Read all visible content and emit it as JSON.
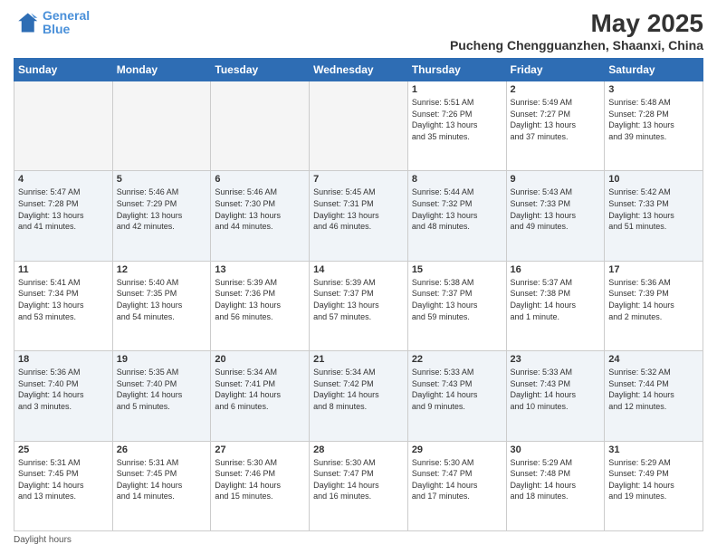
{
  "header": {
    "logo_line1": "General",
    "logo_line2": "Blue",
    "month": "May 2025",
    "location": "Pucheng Chengguanzhen, Shaanxi, China"
  },
  "days_of_week": [
    "Sunday",
    "Monday",
    "Tuesday",
    "Wednesday",
    "Thursday",
    "Friday",
    "Saturday"
  ],
  "footer": {
    "daylight_label": "Daylight hours"
  },
  "weeks": [
    {
      "days": [
        {
          "num": "",
          "info": ""
        },
        {
          "num": "",
          "info": ""
        },
        {
          "num": "",
          "info": ""
        },
        {
          "num": "",
          "info": ""
        },
        {
          "num": "1",
          "info": "Sunrise: 5:51 AM\nSunset: 7:26 PM\nDaylight: 13 hours\nand 35 minutes."
        },
        {
          "num": "2",
          "info": "Sunrise: 5:49 AM\nSunset: 7:27 PM\nDaylight: 13 hours\nand 37 minutes."
        },
        {
          "num": "3",
          "info": "Sunrise: 5:48 AM\nSunset: 7:28 PM\nDaylight: 13 hours\nand 39 minutes."
        }
      ]
    },
    {
      "days": [
        {
          "num": "4",
          "info": "Sunrise: 5:47 AM\nSunset: 7:28 PM\nDaylight: 13 hours\nand 41 minutes."
        },
        {
          "num": "5",
          "info": "Sunrise: 5:46 AM\nSunset: 7:29 PM\nDaylight: 13 hours\nand 42 minutes."
        },
        {
          "num": "6",
          "info": "Sunrise: 5:46 AM\nSunset: 7:30 PM\nDaylight: 13 hours\nand 44 minutes."
        },
        {
          "num": "7",
          "info": "Sunrise: 5:45 AM\nSunset: 7:31 PM\nDaylight: 13 hours\nand 46 minutes."
        },
        {
          "num": "8",
          "info": "Sunrise: 5:44 AM\nSunset: 7:32 PM\nDaylight: 13 hours\nand 48 minutes."
        },
        {
          "num": "9",
          "info": "Sunrise: 5:43 AM\nSunset: 7:33 PM\nDaylight: 13 hours\nand 49 minutes."
        },
        {
          "num": "10",
          "info": "Sunrise: 5:42 AM\nSunset: 7:33 PM\nDaylight: 13 hours\nand 51 minutes."
        }
      ]
    },
    {
      "days": [
        {
          "num": "11",
          "info": "Sunrise: 5:41 AM\nSunset: 7:34 PM\nDaylight: 13 hours\nand 53 minutes."
        },
        {
          "num": "12",
          "info": "Sunrise: 5:40 AM\nSunset: 7:35 PM\nDaylight: 13 hours\nand 54 minutes."
        },
        {
          "num": "13",
          "info": "Sunrise: 5:39 AM\nSunset: 7:36 PM\nDaylight: 13 hours\nand 56 minutes."
        },
        {
          "num": "14",
          "info": "Sunrise: 5:39 AM\nSunset: 7:37 PM\nDaylight: 13 hours\nand 57 minutes."
        },
        {
          "num": "15",
          "info": "Sunrise: 5:38 AM\nSunset: 7:37 PM\nDaylight: 13 hours\nand 59 minutes."
        },
        {
          "num": "16",
          "info": "Sunrise: 5:37 AM\nSunset: 7:38 PM\nDaylight: 14 hours\nand 1 minute."
        },
        {
          "num": "17",
          "info": "Sunrise: 5:36 AM\nSunset: 7:39 PM\nDaylight: 14 hours\nand 2 minutes."
        }
      ]
    },
    {
      "days": [
        {
          "num": "18",
          "info": "Sunrise: 5:36 AM\nSunset: 7:40 PM\nDaylight: 14 hours\nand 3 minutes."
        },
        {
          "num": "19",
          "info": "Sunrise: 5:35 AM\nSunset: 7:40 PM\nDaylight: 14 hours\nand 5 minutes."
        },
        {
          "num": "20",
          "info": "Sunrise: 5:34 AM\nSunset: 7:41 PM\nDaylight: 14 hours\nand 6 minutes."
        },
        {
          "num": "21",
          "info": "Sunrise: 5:34 AM\nSunset: 7:42 PM\nDaylight: 14 hours\nand 8 minutes."
        },
        {
          "num": "22",
          "info": "Sunrise: 5:33 AM\nSunset: 7:43 PM\nDaylight: 14 hours\nand 9 minutes."
        },
        {
          "num": "23",
          "info": "Sunrise: 5:33 AM\nSunset: 7:43 PM\nDaylight: 14 hours\nand 10 minutes."
        },
        {
          "num": "24",
          "info": "Sunrise: 5:32 AM\nSunset: 7:44 PM\nDaylight: 14 hours\nand 12 minutes."
        }
      ]
    },
    {
      "days": [
        {
          "num": "25",
          "info": "Sunrise: 5:31 AM\nSunset: 7:45 PM\nDaylight: 14 hours\nand 13 minutes."
        },
        {
          "num": "26",
          "info": "Sunrise: 5:31 AM\nSunset: 7:45 PM\nDaylight: 14 hours\nand 14 minutes."
        },
        {
          "num": "27",
          "info": "Sunrise: 5:30 AM\nSunset: 7:46 PM\nDaylight: 14 hours\nand 15 minutes."
        },
        {
          "num": "28",
          "info": "Sunrise: 5:30 AM\nSunset: 7:47 PM\nDaylight: 14 hours\nand 16 minutes."
        },
        {
          "num": "29",
          "info": "Sunrise: 5:30 AM\nSunset: 7:47 PM\nDaylight: 14 hours\nand 17 minutes."
        },
        {
          "num": "30",
          "info": "Sunrise: 5:29 AM\nSunset: 7:48 PM\nDaylight: 14 hours\nand 18 minutes."
        },
        {
          "num": "31",
          "info": "Sunrise: 5:29 AM\nSunset: 7:49 PM\nDaylight: 14 hours\nand 19 minutes."
        }
      ]
    }
  ]
}
